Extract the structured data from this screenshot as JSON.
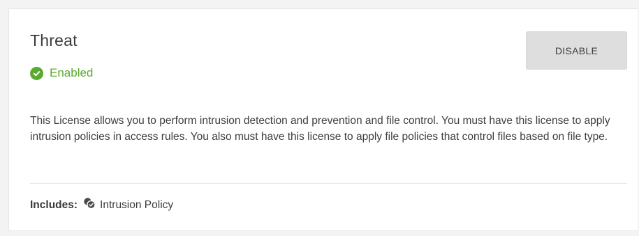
{
  "license": {
    "title": "Threat",
    "status_text": "Enabled",
    "status_icon": "check-circle-icon",
    "status_color": "#5aaa2e",
    "disable_label": "DISABLE",
    "description": "This License allows you to perform intrusion detection and prevention and file control. You must have this license to apply intrusion policies in access rules. You also must have this license to apply file policies that control files based on file type.",
    "includes_label": "Includes:",
    "includes_item": {
      "icon": "intrusion-policy-icon",
      "label": "Intrusion Policy"
    }
  }
}
